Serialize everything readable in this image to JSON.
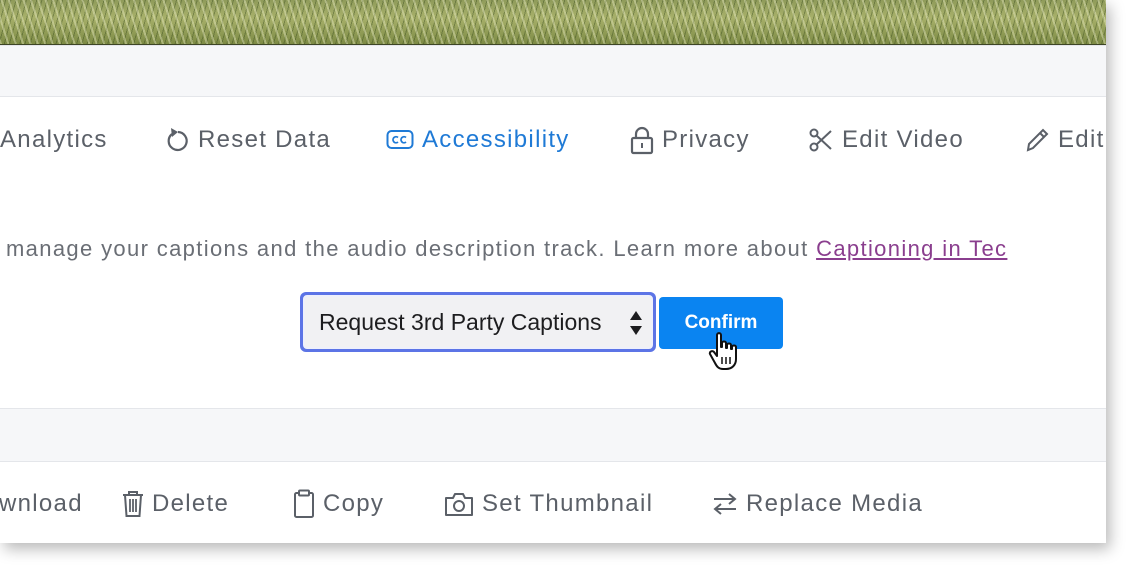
{
  "top_toolbar": {
    "items": [
      {
        "label": "Analytics",
        "icon": "chart-icon"
      },
      {
        "label": "Reset Data",
        "icon": "reset-icon"
      },
      {
        "label": "Accessibility",
        "icon": "closed-captions-icon",
        "active": true
      },
      {
        "label": "Privacy",
        "icon": "lock-icon"
      },
      {
        "label": "Edit Video",
        "icon": "scissors-icon"
      },
      {
        "label": "Edit",
        "icon": "pencil-icon"
      }
    ]
  },
  "captions": {
    "description": "manage your captions and the audio description track. Learn more about ",
    "link_text": "Captioning in Tec",
    "select_value": "Request 3rd Party Captions",
    "confirm_label": "Confirm"
  },
  "bottom_toolbar": {
    "items": [
      {
        "label": "wnload",
        "icon": "download-icon"
      },
      {
        "label": "Delete",
        "icon": "trash-icon"
      },
      {
        "label": "Copy",
        "icon": "clipboard-icon"
      },
      {
        "label": "Set Thumbnail",
        "icon": "camera-icon"
      },
      {
        "label": "Replace Media",
        "icon": "swap-arrows-icon"
      }
    ]
  },
  "colors": {
    "active_tab": "#1f7ad6",
    "confirm_button": "#0a84f1",
    "select_focus_ring": "#5c74e6",
    "link": "#8a3e8e"
  }
}
